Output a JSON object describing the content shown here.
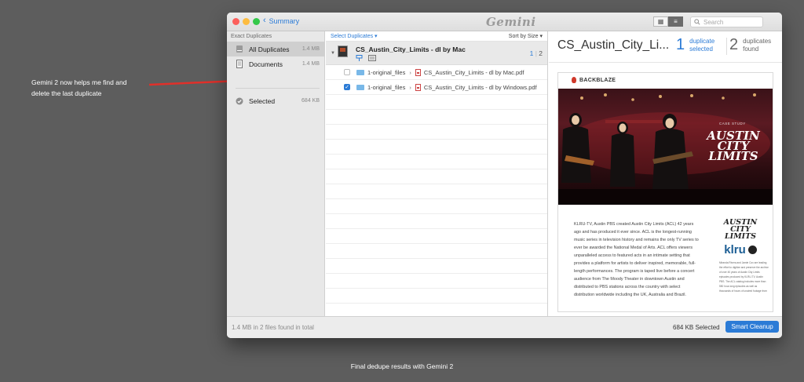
{
  "annotation": {
    "text": "Gemini 2 now helps me find and delete the last duplicate"
  },
  "caption": "Final dedupe results with Gemini 2",
  "titlebar": {
    "back_label": "Summary",
    "app_name": "Gemini",
    "search_placeholder": "Search"
  },
  "sidebar": {
    "header": "Exact Duplicates",
    "items": [
      {
        "label": "All Duplicates",
        "size": "1.4 MB",
        "icon": "drive-icon",
        "active": true
      },
      {
        "label": "Documents",
        "size": "1.4 MB",
        "icon": "document-icon",
        "active": false
      }
    ],
    "selected": {
      "label": "Selected",
      "size": "684 KB",
      "icon": "check-circle-icon"
    }
  },
  "middle": {
    "select_label": "Select Duplicates ▾",
    "sort_label": "Sort by Size ▾",
    "group": {
      "name": "CS_Austin_City_Limits - dl by Mac",
      "count_selected": "1",
      "count_total": "2"
    },
    "files": [
      {
        "folder": "1-original_files",
        "name": "CS_Austin_City_Limits - dl by Mac.pdf",
        "checked": false
      },
      {
        "folder": "1-original_files",
        "name": "CS_Austin_City_Limits - dl by Windows.pdf",
        "checked": true
      }
    ]
  },
  "preview": {
    "title": "CS_Austin_City_Li...",
    "duplicate_count": "1",
    "duplicate_label_1": "duplicate",
    "duplicate_label_2": "selected",
    "found_count": "2",
    "found_label_1": "duplicates",
    "found_label_2": "found",
    "doc": {
      "brand": "BACKBLAZE",
      "case_study": "CASE STUDY",
      "acl_line1": "AUSTIN",
      "acl_line2": "CITY",
      "acl_line3": "LIMITS",
      "body": "KLRU-TV, Austin PBS created Austin City Limits (ACL) 42 years ago and has produced it ever since. ACL is the longest-running music series in television history and remains the only TV series to ever be awarded the National Medal of Arts. ACL offers viewers unparalleled access to featured acts in an intimate setting that provides a platform for artists to deliver inspired, memorable, full-length performances. The program is taped live before a concert audience from The Moody Theater in downtown Austin and distributed to PBS stations across the country with select distribution worldwide including the UK, Australia and Brazil.",
      "side_logo_1": "AUSTIN",
      "side_logo_2": "CITY",
      "side_logo_3": "LIMITS",
      "klru": "klru",
      "side_text": "Miranda Rivera and Jamie Cox are leading the effort to digitize and preserve the archive of over 40 years of Austin City Limits episodes produced by KLRU-TV, Austin PBS. The ACL catalog includes more than 550 hour-long episodes as well as thousands of hours of unaired footage from"
    }
  },
  "statusbar": {
    "summary": "1.4 MB in 2 files found in total",
    "selected": "684 KB Selected",
    "cleanup_label": "Smart Cleanup"
  },
  "colors": {
    "accent": "#2b7bd6",
    "background": "#5d5d5d",
    "arrow": "#e0302a"
  }
}
